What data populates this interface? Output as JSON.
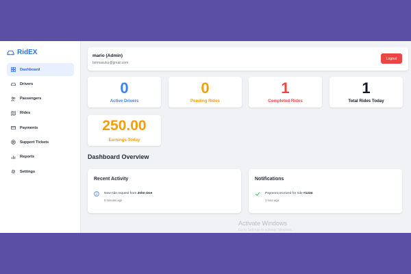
{
  "brand": {
    "name": "RidEX",
    "icon": "car-icon"
  },
  "colors": {
    "brand": "#2f6fe0",
    "active_drivers": "#3b82f6",
    "pending_rides": "#f59e0b",
    "completed_rides": "#ef4444",
    "total_rides": "#111827",
    "earnings": "#f59e0b",
    "logout": "#ef4444"
  },
  "sidebar": {
    "items": [
      {
        "label": "Dashboard",
        "icon": "dashboard-grid-icon",
        "active": true
      },
      {
        "label": "Drivers",
        "icon": "car-icon"
      },
      {
        "label": "Passengers",
        "icon": "users-icon"
      },
      {
        "label": "Rides",
        "icon": "map-icon"
      },
      {
        "label": "Payments",
        "icon": "credit-card-icon"
      },
      {
        "label": "Support Tickets",
        "icon": "lifebuoy-icon"
      },
      {
        "label": "Reports",
        "icon": "bar-chart-icon"
      },
      {
        "label": "Settings",
        "icon": "gear-icon"
      }
    ]
  },
  "header": {
    "user_name": "mario (Admin)",
    "user_email": "bmmasuku@gmail.com",
    "logout_label": "Logout"
  },
  "stats": [
    {
      "value": "0",
      "label": "Active Drivers"
    },
    {
      "value": "0",
      "label": "Pending Rides"
    },
    {
      "value": "1",
      "label": "Completed Rides"
    },
    {
      "value": "1",
      "label": "Total Rides Today"
    }
  ],
  "earnings": {
    "value": "250.00",
    "label": "Earnings Today"
  },
  "overview": {
    "title": "Dashboard Overview",
    "recent_activity": {
      "title": "Recent Activity",
      "icon": "info-icon",
      "text_prefix": "New ride request from ",
      "text_bold": "John Doe",
      "time": "5 minutes ago"
    },
    "notifications": {
      "title": "Notifications",
      "icon": "check-icon",
      "text_prefix": "Payment received for ride ",
      "text_bold": "#1234",
      "time": "1 hour ago"
    }
  },
  "watermark": {
    "title": "Activate Windows",
    "subtitle": "Go to Settings to activate Windows."
  }
}
